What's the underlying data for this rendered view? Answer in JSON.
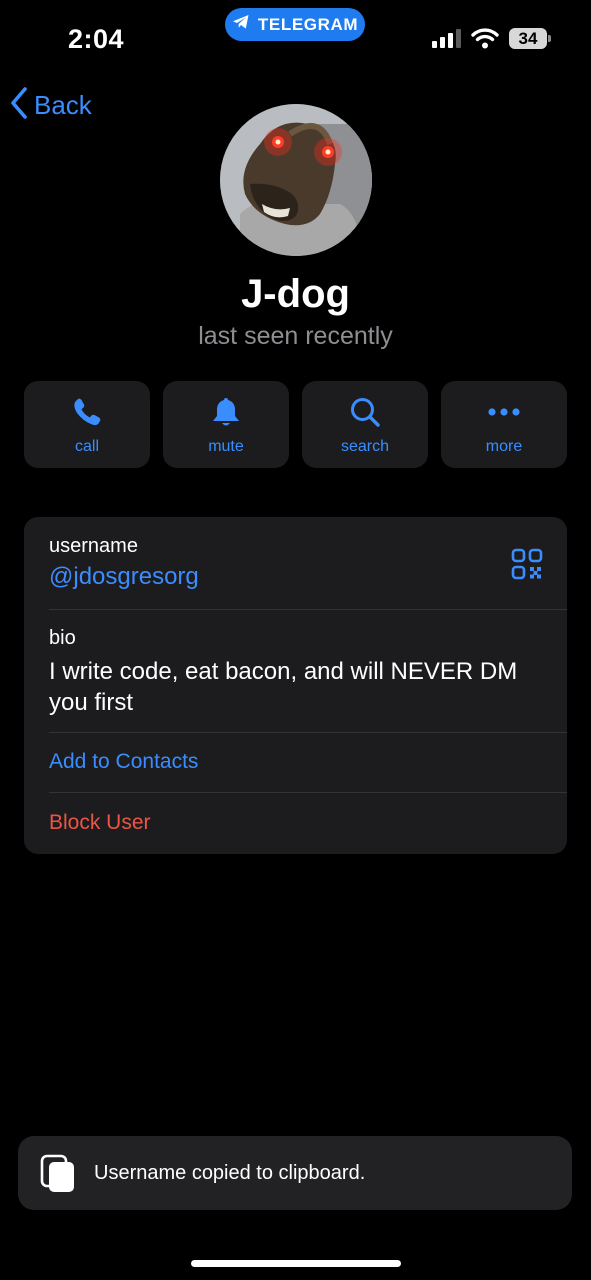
{
  "status_bar": {
    "time": "2:04",
    "app_pill": "TELEGRAM",
    "battery": "34",
    "signal_bars_active": 3,
    "signal_bars_total": 4
  },
  "nav": {
    "back_label": "Back"
  },
  "profile": {
    "name": "J-dog",
    "status": "last seen recently"
  },
  "actions": [
    {
      "label": "call",
      "icon": "phone-icon"
    },
    {
      "label": "mute",
      "icon": "bell-icon"
    },
    {
      "label": "search",
      "icon": "search-icon"
    },
    {
      "label": "more",
      "icon": "more-icon"
    }
  ],
  "info": {
    "username_label": "username",
    "username": "@jdosgresorg",
    "bio_label": "bio",
    "bio": "I write code, eat bacon, and will NEVER DM you first",
    "add_contact": "Add to Contacts",
    "block_user": "Block User"
  },
  "toast": {
    "text": "Username copied to clipboard.",
    "icon": "copy-icon"
  },
  "colors": {
    "accent": "#3a8dff",
    "danger": "#eb5545",
    "card": "#1c1c1e",
    "pill": "#1e7cf0"
  }
}
